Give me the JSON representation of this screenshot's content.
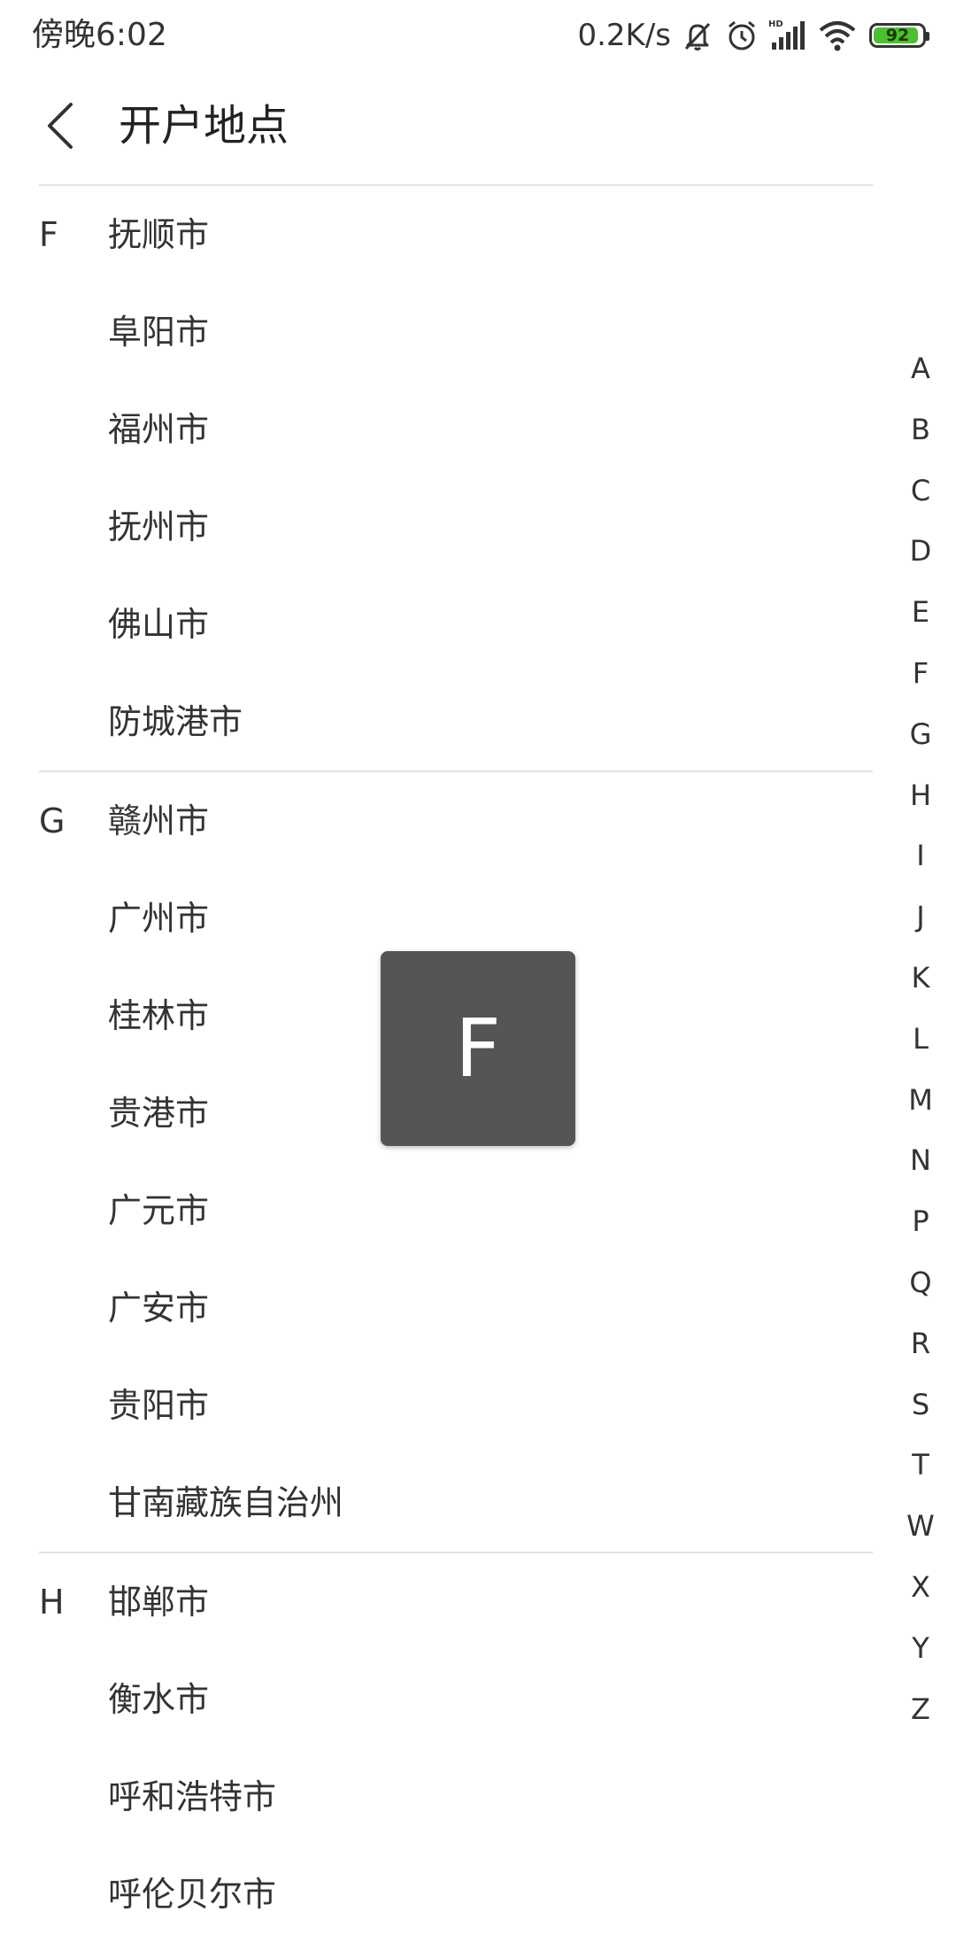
{
  "status_bar": {
    "time": "傍晚6:02",
    "net_speed": "0.2K/s",
    "battery_level": "92",
    "battery_color": "#4cc02e",
    "icons": [
      "mute-bell-icon",
      "alarm-icon",
      "hd-signal-icon",
      "wifi-icon",
      "battery-icon"
    ]
  },
  "header": {
    "back_icon": "chevron-left-icon",
    "title": "开户地点"
  },
  "groups": [
    {
      "letter": "F",
      "cities": [
        "抚顺市",
        "阜阳市",
        "福州市",
        "抚州市",
        "佛山市",
        "防城港市"
      ]
    },
    {
      "letter": "G",
      "cities": [
        "赣州市",
        "广州市",
        "桂林市",
        "贵港市",
        "广元市",
        "广安市",
        "贵阳市",
        "甘南藏族自治州"
      ]
    },
    {
      "letter": "H",
      "cities": [
        "邯郸市",
        "衡水市",
        "呼和浩特市",
        "呼伦贝尔市"
      ]
    }
  ],
  "index_letters": [
    "A",
    "B",
    "C",
    "D",
    "E",
    "F",
    "G",
    "H",
    "I",
    "J",
    "K",
    "L",
    "M",
    "N",
    "P",
    "Q",
    "R",
    "S",
    "T",
    "W",
    "X",
    "Y",
    "Z"
  ],
  "toast": {
    "letter": "F"
  }
}
